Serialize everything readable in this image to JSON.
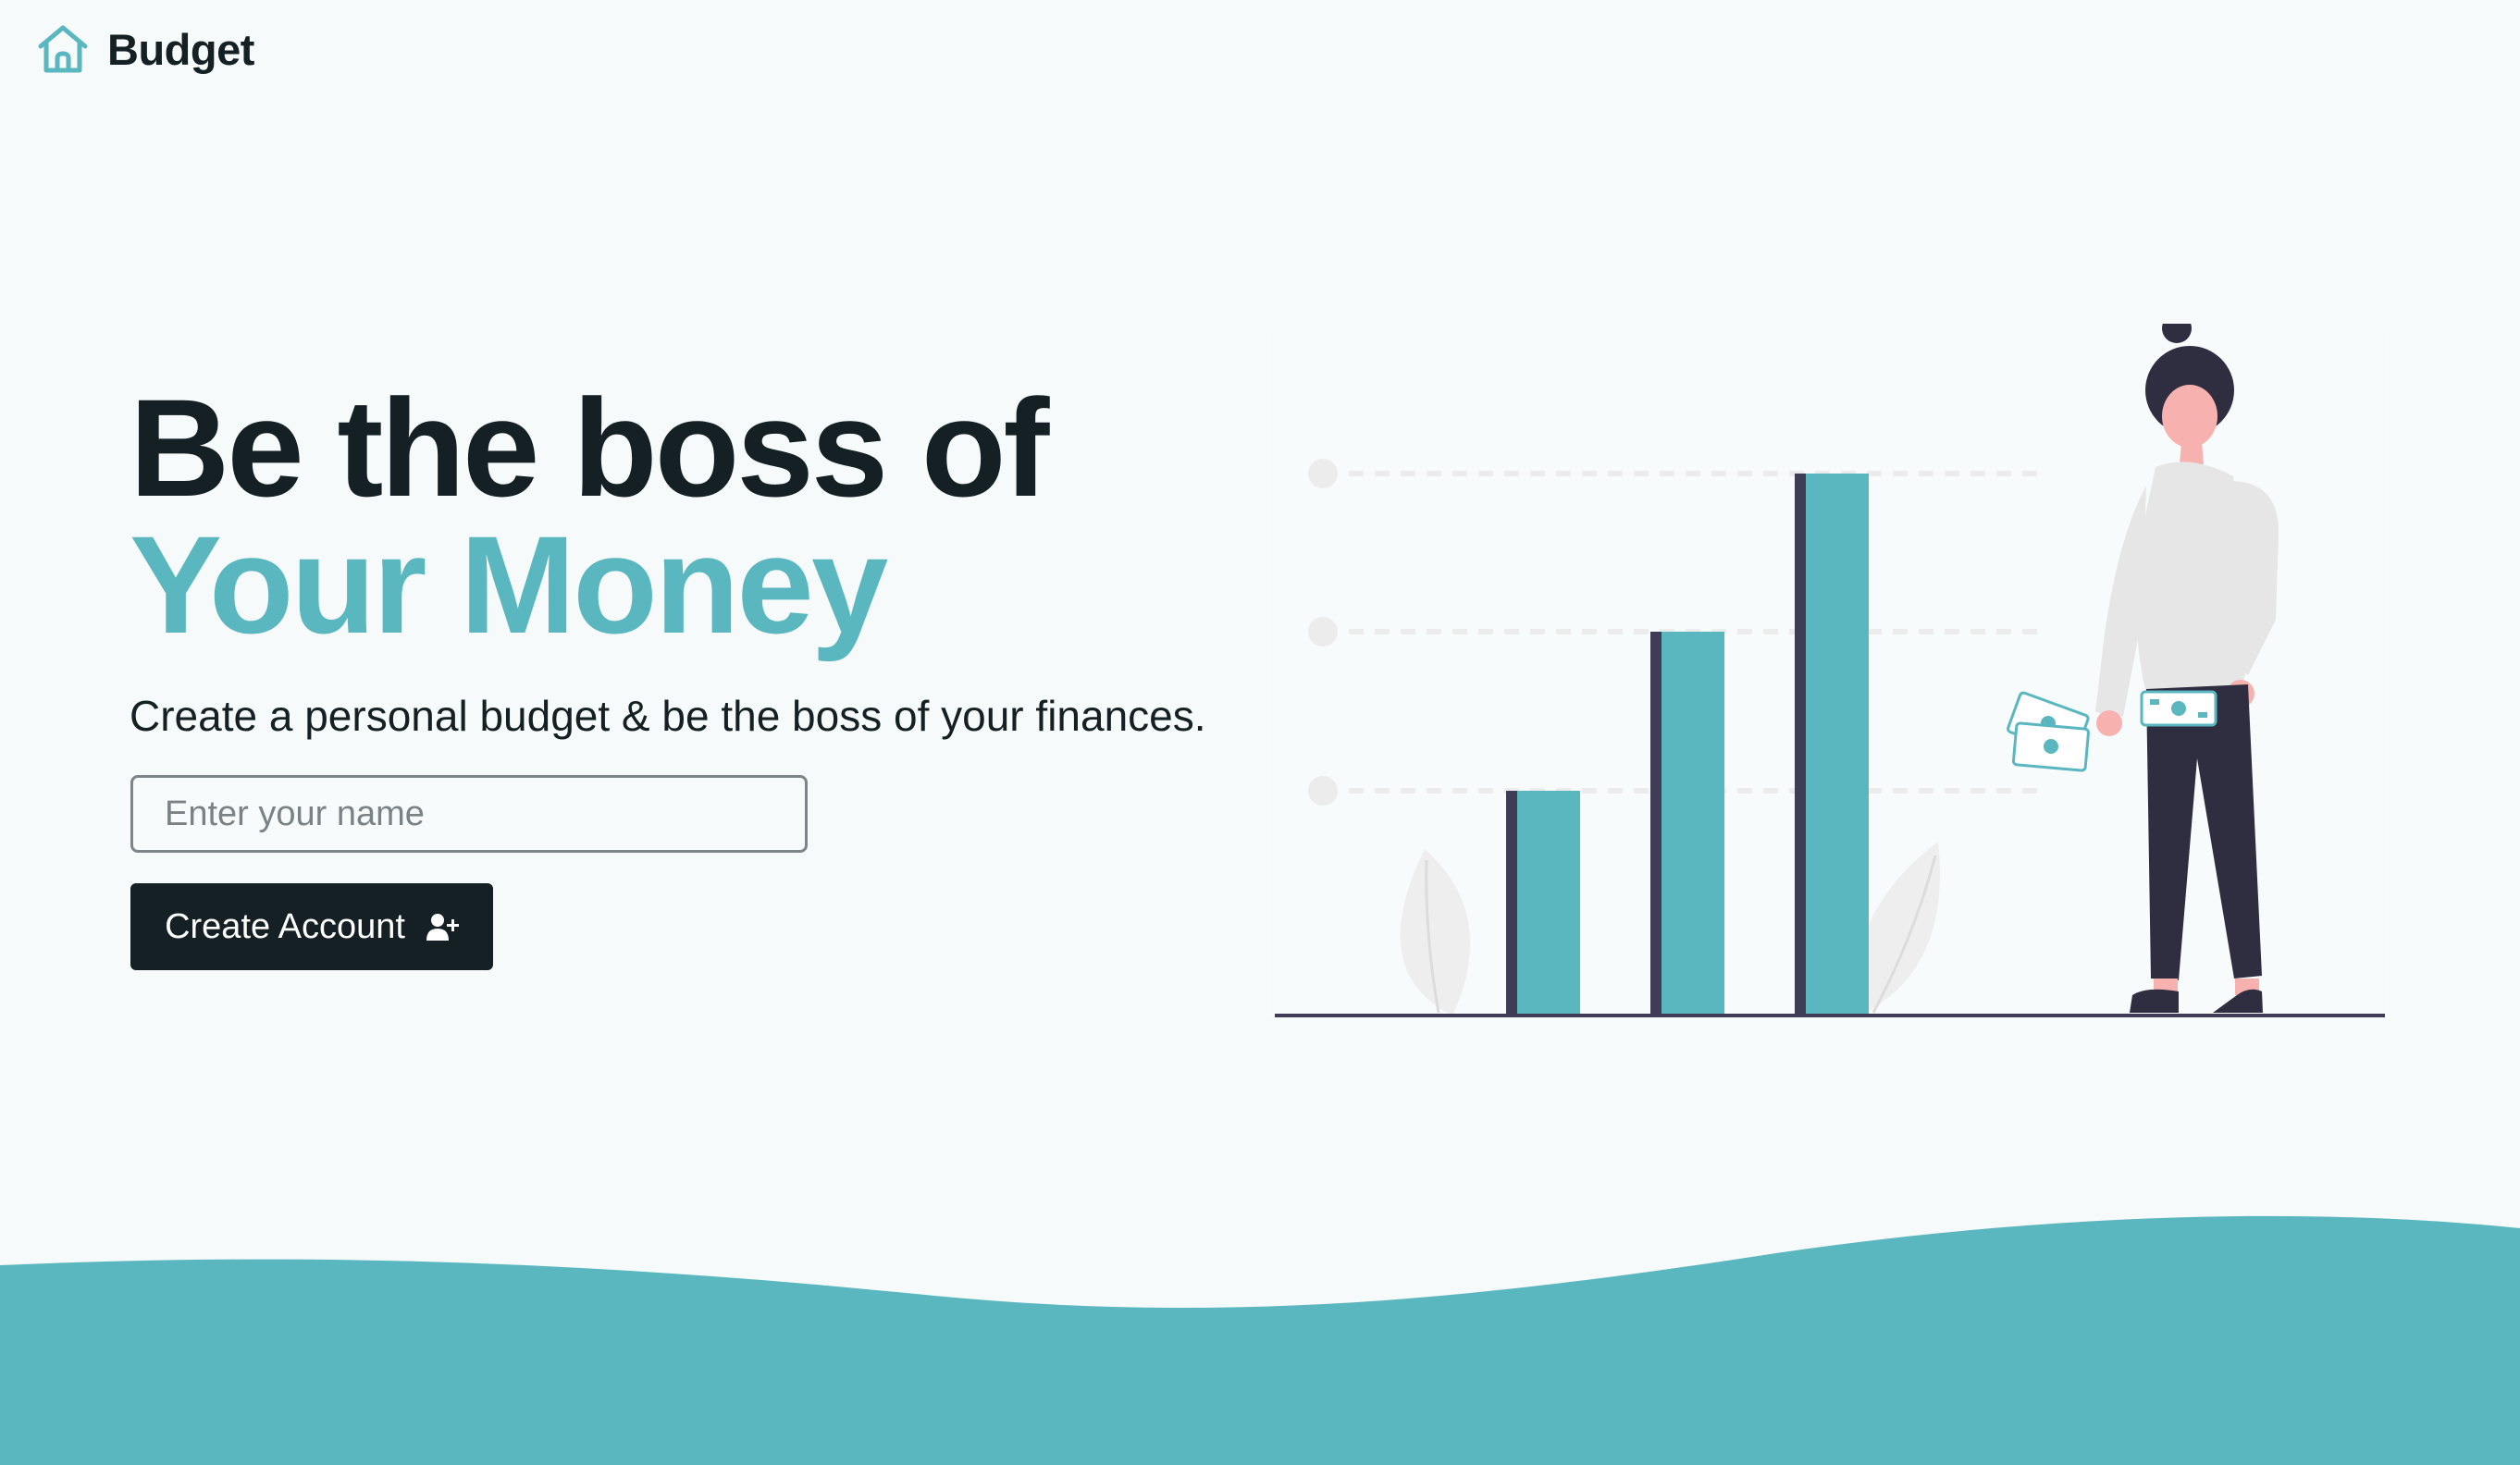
{
  "brand": {
    "name": "Budget",
    "icon": "home-icon"
  },
  "hero": {
    "title_line1": "Be the boss of",
    "title_line2": "Your Money",
    "subtitle": "Create a personal budget & be the boss of your finances."
  },
  "form": {
    "name_placeholder": "Enter your name",
    "name_value": "",
    "submit_label": "Create Account",
    "submit_icon": "user-plus-icon"
  },
  "illustration": {
    "bar_levels": [
      1,
      2,
      3
    ]
  },
  "colors": {
    "accent": "#5ab7c0",
    "dark": "#142023",
    "background": "#f6fafb"
  }
}
